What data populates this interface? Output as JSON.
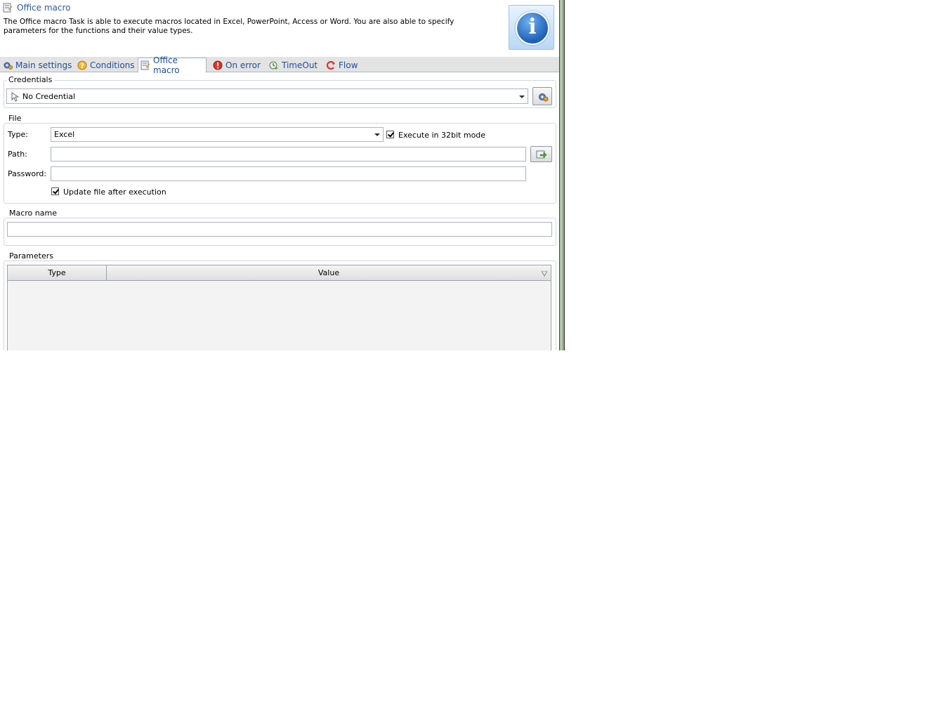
{
  "header": {
    "title": "Office macro",
    "description": "The Office macro Task is able to execute macros located in Excel, PowerPoint, Access or Word. You are also able to specify parameters for the functions and their value types."
  },
  "tabs": [
    {
      "label": "Main settings",
      "icon": "gear-icon"
    },
    {
      "label": "Conditions",
      "icon": "question-icon"
    },
    {
      "label": "Office macro",
      "icon": "macro-icon",
      "active": true
    },
    {
      "label": "On error",
      "icon": "error-icon"
    },
    {
      "label": "TimeOut",
      "icon": "timeout-icon"
    },
    {
      "label": "Flow",
      "icon": "flow-icon"
    }
  ],
  "credentials": {
    "label": "Credentials",
    "selected": "No Credential"
  },
  "file": {
    "label": "File",
    "type_label": "Type:",
    "type_value": "Excel",
    "exec32_label": "Execute in 32bit mode",
    "exec32_checked": true,
    "path_label": "Path:",
    "path_value": "",
    "password_label": "Password:",
    "password_value": "",
    "update_label": "Update file after execution",
    "update_checked": true
  },
  "macro": {
    "label": "Macro name",
    "value": ""
  },
  "parameters": {
    "label": "Parameters",
    "columns": [
      "Type",
      "Value"
    ],
    "rows": []
  },
  "colors": {
    "accent": "#2a5aa8",
    "tab_text": "#1f4f9c"
  }
}
